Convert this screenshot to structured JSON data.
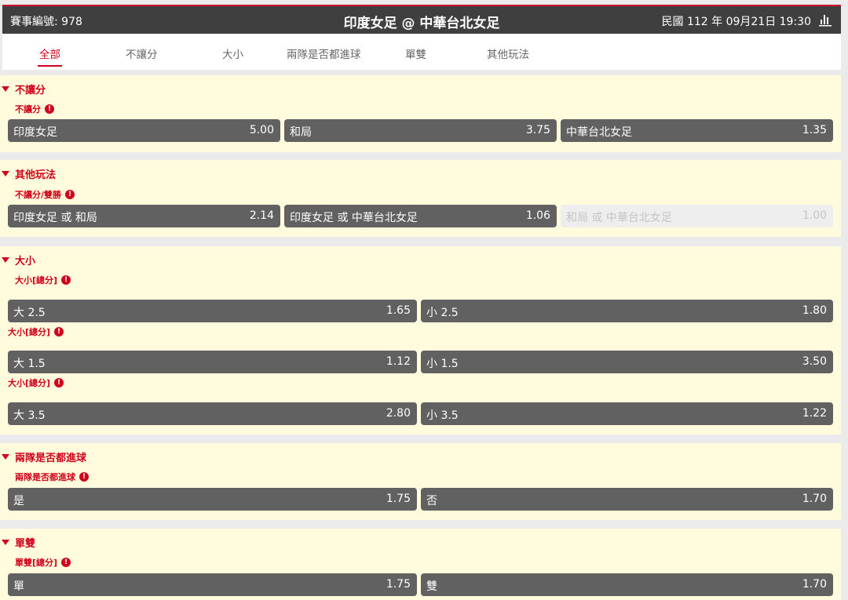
{
  "header": {
    "event_id": "賽事編號: 978",
    "title": "印度女足 @ 中華台北女足",
    "datetime": "民國 112 年 09月21日 19:30",
    "stats_icon": "bar-chart-icon"
  },
  "tabs": [
    {
      "label": "全部"
    },
    {
      "label": "不讓分"
    },
    {
      "label": "大小"
    },
    {
      "label": "兩隊是否都進球"
    },
    {
      "label": "單雙"
    },
    {
      "label": "其他玩法"
    }
  ],
  "colors": {
    "accent": "#d0021b",
    "header_bg": "#3f3f3f",
    "section_bg": "#fffbdc",
    "cell_bg": "#616161",
    "page_bg": "#ebebeb"
  },
  "sections": [
    {
      "title": "不讓分",
      "markets": [
        {
          "label": "不讓分",
          "selections": [
            {
              "name": "印度女足",
              "odds": "5.00"
            },
            {
              "name": "和局",
              "odds": "3.75"
            },
            {
              "name": "中華台北女足",
              "odds": "1.35"
            }
          ]
        }
      ]
    },
    {
      "title": "其他玩法",
      "markets": [
        {
          "label": "不讓分/雙勝",
          "selections": [
            {
              "name": "印度女足 或 和局",
              "odds": "2.14"
            },
            {
              "name": "印度女足 或 中華台北女足",
              "odds": "1.06"
            },
            {
              "name": "和局 或 中華台北女足",
              "odds": "1.00",
              "disabled": true
            }
          ]
        }
      ]
    },
    {
      "title": "大小",
      "markets": [
        {
          "label": "大小[總分]",
          "selections": [
            {
              "name": "大 2.5",
              "odds": "1.65"
            },
            {
              "name": "小 2.5",
              "odds": "1.80"
            }
          ]
        },
        {
          "label": "大小[總分]",
          "selections": [
            {
              "name": "大 1.5",
              "odds": "1.12"
            },
            {
              "name": "小 1.5",
              "odds": "3.50"
            }
          ]
        },
        {
          "label": "大小[總分]",
          "selections": [
            {
              "name": "大 3.5",
              "odds": "2.80"
            },
            {
              "name": "小 3.5",
              "odds": "1.22"
            }
          ]
        }
      ]
    },
    {
      "title": "兩隊是否都進球",
      "markets": [
        {
          "label": "兩隊是否都進球",
          "selections": [
            {
              "name": "是",
              "odds": "1.75"
            },
            {
              "name": "否",
              "odds": "1.70"
            }
          ]
        }
      ]
    },
    {
      "title": "單雙",
      "markets": [
        {
          "label": "單雙[總分]",
          "selections": [
            {
              "name": "單",
              "odds": "1.75"
            },
            {
              "name": "雙",
              "odds": "1.70"
            }
          ]
        }
      ]
    }
  ]
}
